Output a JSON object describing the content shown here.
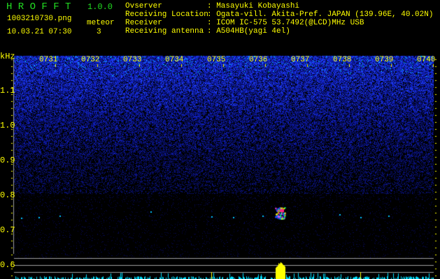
{
  "header": {
    "app_name": "H R O F F T",
    "version": "1.0.0",
    "filename": "1003210730.png",
    "datetime": "10.03.21 07:30",
    "meteor_label": "meteor",
    "meteor_count": "3"
  },
  "info": [
    {
      "label": "Ovserver",
      "value": ": Masayuki Kobayashi"
    },
    {
      "label": "Receiving Location",
      "value": ": Ogata-vill. Akita-Pref. JAPAN (139.96E, 40.02N)"
    },
    {
      "label": "Receiver",
      "value": ": ICOM IC-575 53.7492(@LCD)MHz USB"
    },
    {
      "label": "Receiving antenna",
      "value": ": A504HB(yagi 4el)"
    }
  ],
  "chart_data": {
    "type": "heatmap",
    "ylabel": "kHz",
    "y_ticks": [
      "1.1",
      "1.0",
      "0.9",
      "0.8",
      "0.7",
      "0.6"
    ],
    "ylim": [
      0.58,
      1.2
    ],
    "x_ticks": [
      "0731",
      "0732",
      "0733",
      "0734",
      "0735",
      "0736",
      "0737",
      "0738",
      "0739",
      "0740"
    ],
    "xlim": [
      "0730",
      "0740"
    ],
    "meteor_echo": {
      "time": "0736.2",
      "freq_khz": 0.745
    },
    "colors": {
      "noise": "#1a2bff",
      "strong": "#ff2080",
      "histogram": "#00e0ff",
      "detection": "#ffff00",
      "reference_lines": "#a0a0a0"
    }
  }
}
